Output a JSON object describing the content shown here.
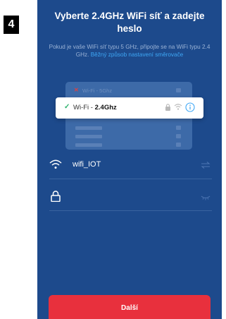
{
  "step": {
    "number": "4"
  },
  "header": {
    "title": "Vyberte 2.4GHz WiFi síť a zadejte heslo",
    "subtitle_text": "Pokud je vaše WiFi síť typu 5 GHz, připojte se na WiFi typu 2.4 GHz.",
    "subtitle_link": "Běžný způsob nastavení směrovače"
  },
  "illustration": {
    "wrong_network": "Wi-Fi - 5Ghz",
    "selected_prefix": "Wi-Fi - ",
    "selected_band": "2.4Ghz"
  },
  "form": {
    "ssid_value": "wifi_IOT",
    "password_value": ""
  },
  "footer": {
    "next_label": "Další"
  },
  "colors": {
    "background": "#1d4a8c",
    "primary_button": "#e8303d",
    "link": "#3ea7f5",
    "check": "#2fb36e"
  }
}
